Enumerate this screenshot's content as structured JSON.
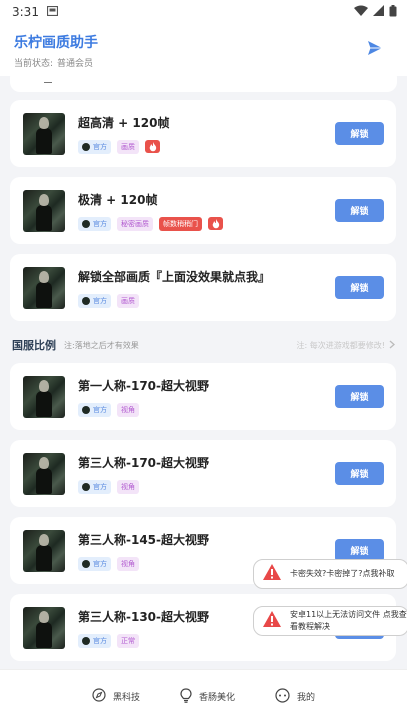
{
  "status_bar": {
    "time": "3:31"
  },
  "header": {
    "title": "乐柠画质助手",
    "status_label": "当前状态:",
    "status_value": "普通会员"
  },
  "items_top": [
    {
      "title": "超高清 + 120帧",
      "tags": [
        "官方",
        "画质"
      ],
      "badge": null,
      "fire": true,
      "button": "解锁"
    },
    {
      "title": "极清 + 120帧",
      "tags": [
        "官方",
        "秘密画质"
      ],
      "badge": "帧数稍稍门",
      "fire": true,
      "button": "解锁"
    },
    {
      "title": "解锁全部画质『上面没效果就点我』",
      "tags": [
        "官方",
        "画质"
      ],
      "badge": null,
      "fire": false,
      "button": "解锁"
    }
  ],
  "section": {
    "title": "国服比例",
    "note": "注:落地之后才有效果",
    "right_note": "注: 每次进游戏都要修改!"
  },
  "items_ratio": [
    {
      "title": "第一人称-170-超大视野",
      "tags": [
        "官方",
        "视角"
      ],
      "button": "解锁"
    },
    {
      "title": "第三人称-170-超大视野",
      "tags": [
        "官方",
        "视角"
      ],
      "button": "解锁"
    },
    {
      "title": "第三人称-145-超大视野",
      "tags": [
        "官方",
        "视角"
      ],
      "button": "解锁"
    },
    {
      "title": "第三人称-130-超大视野",
      "tags": [
        "官方",
        "正常"
      ],
      "button": "解锁"
    }
  ],
  "toasts": [
    {
      "text": "卡密失效?卡密掉了?点我补取"
    },
    {
      "text": "安卓11以上无法访问文件 点我查看教程解决"
    }
  ],
  "bottom_nav": [
    {
      "label": "黑科技",
      "icon": "compass-icon"
    },
    {
      "label": "香肠美化",
      "icon": "lightbulb-icon"
    },
    {
      "label": "我的",
      "icon": "profile-icon"
    }
  ],
  "colors": {
    "accent": "#3d7be0",
    "button": "#5b8ee6",
    "hot": "#e9524b",
    "warning": "#e84848"
  }
}
